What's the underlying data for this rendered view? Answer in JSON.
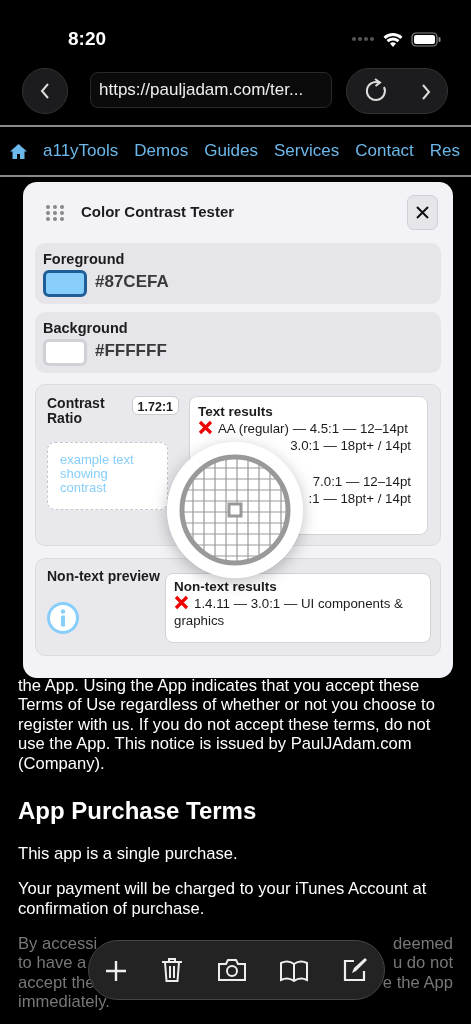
{
  "status_bar": {
    "time": "8:20"
  },
  "browser": {
    "url": "https://pauljadam.com/ter..."
  },
  "nav": {
    "items": [
      {
        "label": "a11yTools"
      },
      {
        "label": "Demos"
      },
      {
        "label": "Guides"
      },
      {
        "label": "Services"
      },
      {
        "label": "Contact"
      },
      {
        "label": "Res"
      }
    ]
  },
  "page": {
    "paragraph": "the App. Using the App indicates that you accept these Terms of Use regardless of whether or not you choose to register with us. If you do not accept these terms, do not use the App. This notice is issued by PaulJAdam.com (Company).",
    "heading": "App Purchase Terms",
    "paragraphs": [
      "This app is a single purchase.",
      "Your payment will be charged to your iTunes Account at confirmation of purchase."
    ],
    "faded_lines": [
      [
        "By accessi",
        "deemed"
      ],
      [
        "to have a",
        "u do not"
      ],
      [
        "accept the",
        "e the App"
      ],
      [
        "immediately."
      ]
    ]
  },
  "dialog": {
    "title": "Color Contrast Tester",
    "colors": [
      {
        "label": "Foreground",
        "value": "#87CEFA",
        "color": "#87cefa",
        "selected": true
      },
      {
        "label": "Background",
        "value": "#FFFFFF",
        "color": "#ffffff",
        "selected": false
      }
    ],
    "contrast": {
      "label": "Contrast Ratio",
      "ratio": "1.72:1",
      "example_text": "example text showing contrast",
      "results_title": "Text results",
      "result_groups": [
        {
          "rows": [
            {
              "text": "AA (regular) — 4.5:1 — 12–14pt",
              "passed": false
            },
            {
              "text": "3.0:1 — 18pt+ / 14pt"
            }
          ]
        },
        {
          "rows": [
            {
              "text": "7.0:1 — 12–14pt"
            },
            {
              "text": ":1 — 18pt+ / 14pt"
            }
          ]
        }
      ]
    },
    "non_text": {
      "label": "Non-text preview",
      "results_title": "Non-text results",
      "results": [
        {
          "text": "1.4.11 — 3.0:1 — UI components & graphics",
          "passed": false
        }
      ]
    }
  }
}
